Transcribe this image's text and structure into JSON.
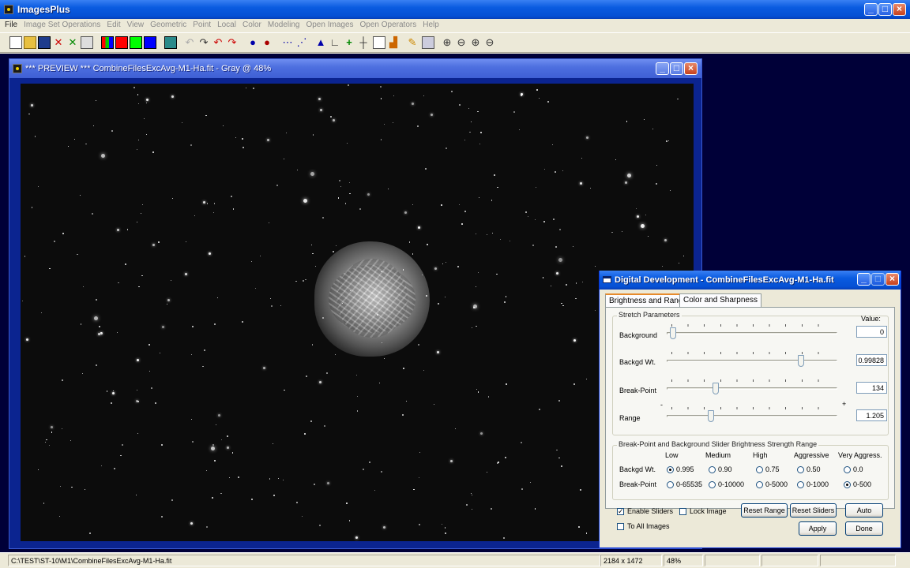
{
  "app": {
    "title": "ImagesPlus"
  },
  "menu": [
    "File",
    "Image Set Operations",
    "Edit",
    "View",
    "Geometric",
    "Point",
    "Local",
    "Color",
    "Modeling",
    "Open Images",
    "Open Operators",
    "Help"
  ],
  "preview": {
    "title": "*** PREVIEW *** CombineFilesExcAvg-M1-Ha.fit - Gray @ 48%"
  },
  "dialog": {
    "title": "Digital Development - CombineFilesExcAvg-M1-Ha.fit",
    "tabs": [
      "Brightness and Range",
      "Color and Sharpness"
    ],
    "stretch": {
      "group_label": "Stretch Parameters",
      "value_header": "Value:",
      "background": {
        "label": "Background",
        "value": "0",
        "pos": 0.02
      },
      "backgd_wt": {
        "label": "Backgd Wt.",
        "value": "0.99828",
        "pos": 0.8
      },
      "break_point": {
        "label": "Break-Point",
        "value": "134",
        "pos": 0.28
      },
      "range": {
        "label": "Range",
        "value": "1.205",
        "pos": 0.25,
        "minus": "-",
        "plus": "+"
      }
    },
    "strength": {
      "group_label": "Break-Point and Background Slider Brightness Strength Range",
      "columns": [
        "Low",
        "Medium",
        "High",
        "Aggressive",
        "Very Aggress."
      ],
      "backgd_label": "Backgd Wt.",
      "backgd_options": [
        "0.995",
        "0.90",
        "0.75",
        "0.50",
        "0.0"
      ],
      "backgd_selected": 0,
      "break_label": "Break-Point",
      "break_options": [
        "0-65535",
        "0-10000",
        "0-5000",
        "0-1000",
        "0-500"
      ],
      "break_selected": 4
    },
    "enable_sliders": "Enable Sliders",
    "lock_image": "Lock Image",
    "to_all_images": "To All Images",
    "buttons": {
      "reset_range": "Reset Range",
      "reset_sliders": "Reset Sliders",
      "auto": "Auto",
      "apply": "Apply",
      "done": "Done"
    }
  },
  "status": {
    "path": "C:\\TEST\\ST-10\\M1\\CombineFilesExcAvg-M1-Ha.fit",
    "dimensions": "2184 x 1472",
    "zoom": "48%"
  }
}
